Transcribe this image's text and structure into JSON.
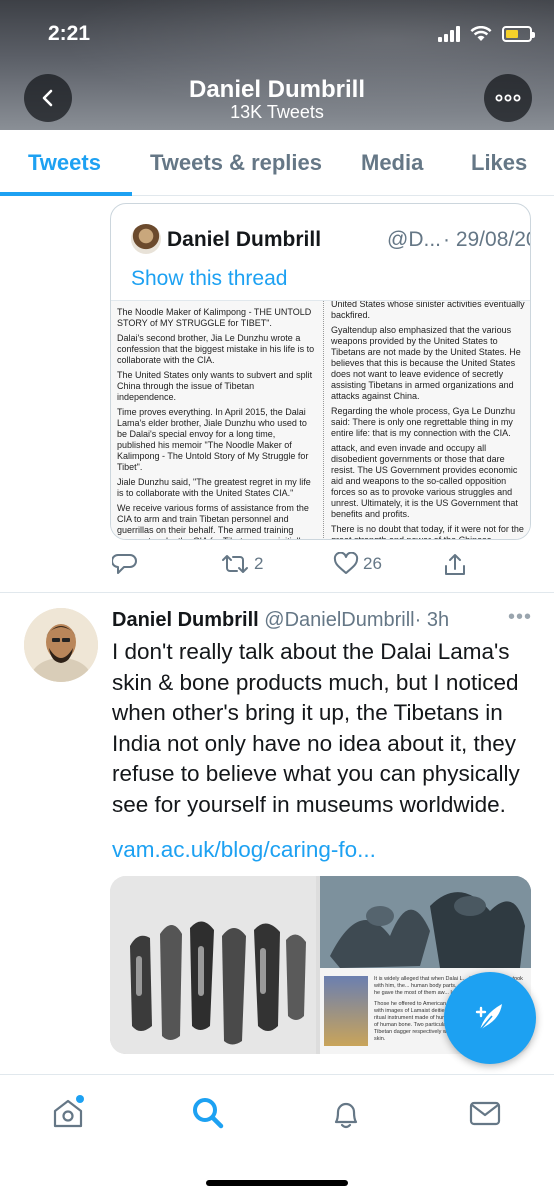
{
  "status": {
    "time": "2:21"
  },
  "header": {
    "name": "Daniel Dumbrill",
    "tweet_count": "13K Tweets"
  },
  "tabs": [
    {
      "label": "Tweets",
      "active": true
    },
    {
      "label": "Tweets & replies"
    },
    {
      "label": "Media"
    },
    {
      "label": "Likes"
    }
  ],
  "quoted_tweet": {
    "name": "Daniel Dumbrill",
    "handle": "@D...",
    "date": "· 29/08/20",
    "show_thread": "Show this thread",
    "doc_left": [
      "The Noodle Maker of Kalimpong - THE UNTOLD STORY of MY STRUGGLE for TIBET\".",
      "Dalai's second brother, Jia Le Dunzhu wrote a confession that the biggest mistake in his life is to collaborate with the CIA.",
      "The United States only wants to subvert and split China through the issue of Tibetan independence.",
      "Time proves everything. In April 2015, the Dalai Lama's elder brother, Jiale Dunzhu who used to be Dalai's special envoy for a long time, published his memoir \"The Noodle Maker of Kalimpong - The Untold Story of My Struggle for Tibet\".",
      "Jiale Dunzhu said, \"The greatest regret in my life is to collaborate with the United States CIA.\"",
      "We receive various forms of assistance from the CIA to arm and train Tibetan personnel and guerrillas on their behalf. The armed training base set up by the CIA for Tibetans was initially selected near the India-Pakistan border and later moved to Mustang in Nepal United States. We captured important information from the Chinese Government for the CIA."
    ],
    "doc_right": [
      "United States whose sinister activities eventually backfired.",
      "Gyaltendup also emphasized that the various weapons provided by the United States to Tibetans are not made by the United States. He believes that this is because the United States does not want to leave evidence of secretly assisting Tibetans in armed organizations and attacks against China.",
      "Regarding the whole process, Gya Le Dunzhu said: There is only one regrettable thing in my entire life: that is my connection with the CIA.",
      "attack, and even invade and occupy all disobedient governments or those that dare resist. The US Government provides economic aid and weapons to the so-called opposition forces so as to provoke various struggles and unrest. Ultimately, it is the US Government that benefits and profits.",
      "There is no doubt that today, if it were not for the great strength and power of the Chinese Government, the entire continent would have already become the blood-soaked purgatory as has happened to the Middle Eastern countries like Iraq, Libya, Syria as well"
    ]
  },
  "tweet_actions": {
    "retweets": "2",
    "likes": "26"
  },
  "tweet2": {
    "name": "Daniel Dumbrill",
    "handle": "@DanielDumbrill",
    "time": "· 3h",
    "more": "•••",
    "text": "I don't really talk about the Dalai Lama's skin & bone products much, but I noticed when other's bring it up, the Tibetans in India not only have no idea about it, they refuse to believe what you can physically see for yourself in museums worldwide.",
    "link": "vam.ac.uk/blog/caring-fo...",
    "media_text_1": "It is widely alleged that when Dalai L... the things that he took with him, the... human body parts, and over the yea... planet, he gave the most of them aw... Indian politicians.",
    "media_text_2": "Those he offered to American governme... (cards painted with images of Lamaist deities... skin, a Tibetan Lamaism ritual instrument made of human skull and a sutra tube made of human bone. Two particular US politicians also received a Tibetan dagger respectively with the sheath clad in human skin."
  },
  "nav": [
    "home",
    "search",
    "notifications",
    "messages"
  ],
  "colors": {
    "accent": "#1da1f2",
    "text": "#14171a",
    "muted": "#657786",
    "border": "#e1e8ed"
  }
}
